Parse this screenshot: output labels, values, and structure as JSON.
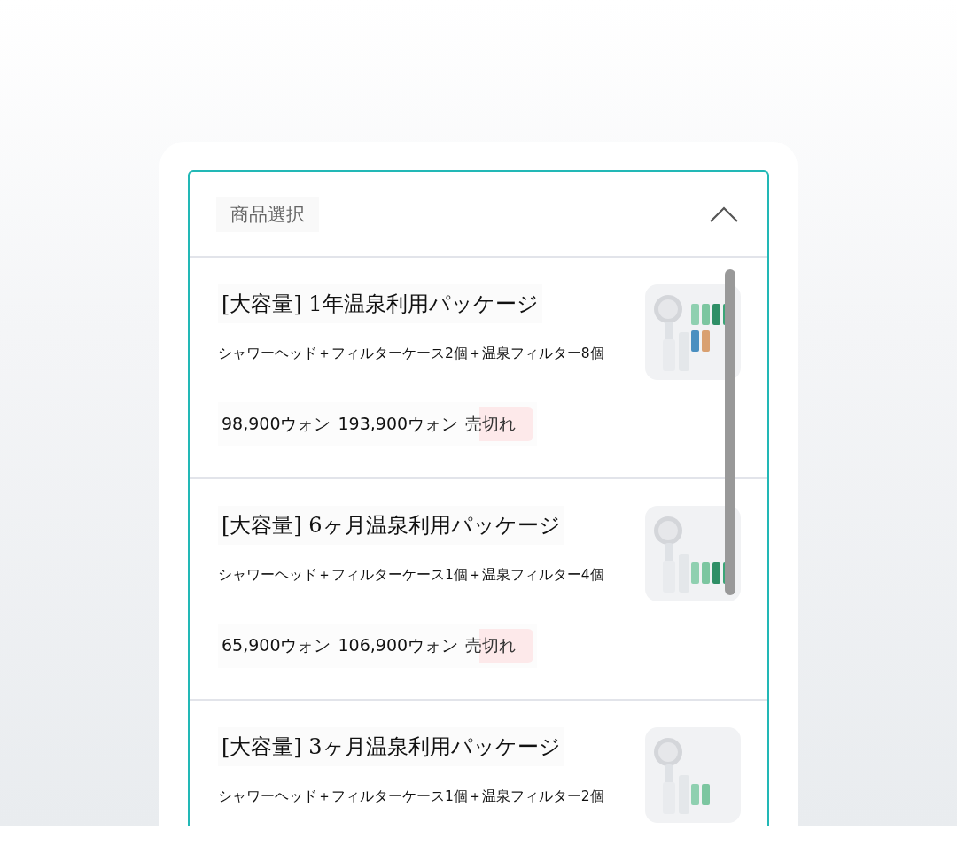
{
  "selector": {
    "title": "商品選択",
    "expanded": true
  },
  "products": [
    {
      "name": "[大容量] 1年温泉利用パッケージ",
      "description": "シャワーヘッド＋フィルターケース2個＋温泉フィルター8個",
      "prices": [
        "98,900ウォン",
        "193,900ウォン"
      ],
      "sold_out": true,
      "badge": "売切れ"
    },
    {
      "name": "[大容量] 6ヶ月温泉利用パッケージ",
      "description": "シャワーヘッド＋フィルターケース1個＋温泉フィルター4個",
      "prices": [
        "65,900ウォン",
        "106,900ウォン"
      ],
      "sold_out": true,
      "badge": "売切れ"
    },
    {
      "name": "[大容量] 3ヶ月温泉利用パッケージ",
      "description": "シャワーヘッド＋フィルターケース1個＋温泉フィルター2個"
    }
  ]
}
